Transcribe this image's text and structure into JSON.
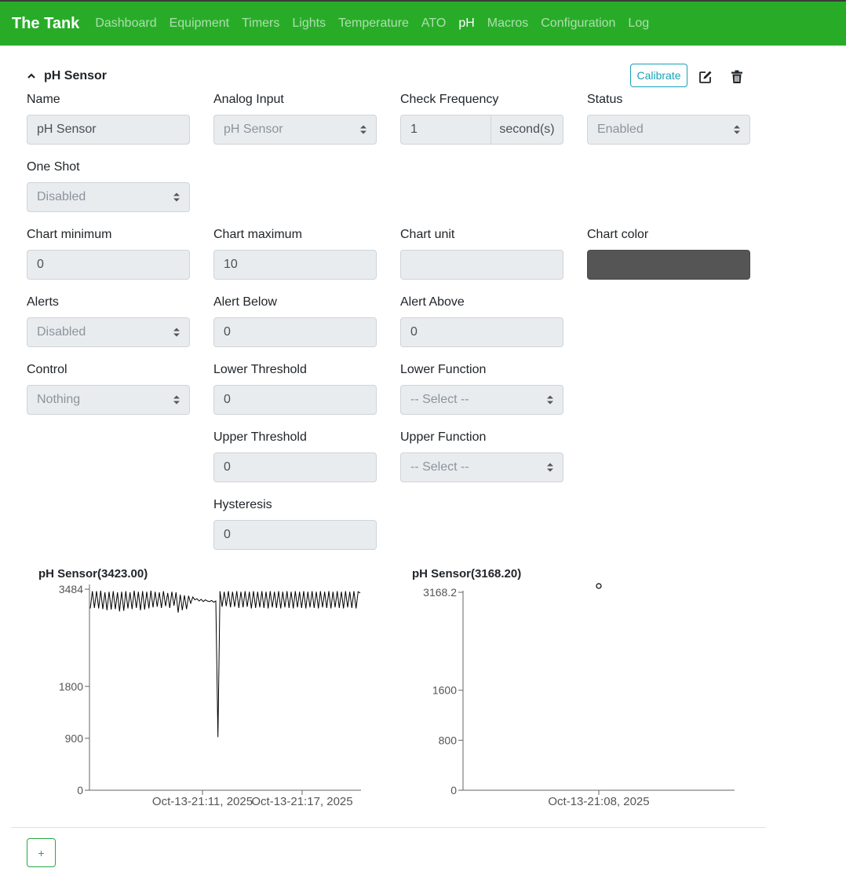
{
  "navbar": {
    "brand": "The Tank",
    "items": [
      {
        "label": "Dashboard",
        "active": false
      },
      {
        "label": "Equipment",
        "active": false
      },
      {
        "label": "Timers",
        "active": false
      },
      {
        "label": "Lights",
        "active": false
      },
      {
        "label": "Temperature",
        "active": false
      },
      {
        "label": "ATO",
        "active": false
      },
      {
        "label": "pH",
        "active": true
      },
      {
        "label": "Macros",
        "active": false
      },
      {
        "label": "Configuration",
        "active": false
      },
      {
        "label": "Log",
        "active": false
      }
    ]
  },
  "section": {
    "title": "pH Sensor",
    "collapse_icon": "chevron-up-icon",
    "calibrate_label": "Calibrate",
    "edit_icon": "edit-icon",
    "delete_icon": "trash-icon"
  },
  "form": {
    "name": {
      "label": "Name",
      "value": "pH Sensor"
    },
    "analog_input": {
      "label": "Analog Input",
      "value": "pH Sensor"
    },
    "check_frequency": {
      "label": "Check Frequency",
      "value": "1",
      "unit": "second(s)"
    },
    "status": {
      "label": "Status",
      "value": "Enabled"
    },
    "one_shot": {
      "label": "One Shot",
      "value": "Disabled"
    },
    "chart_min": {
      "label": "Chart minimum",
      "value": "0"
    },
    "chart_max": {
      "label": "Chart maximum",
      "value": "10"
    },
    "chart_unit": {
      "label": "Chart unit",
      "value": ""
    },
    "chart_color": {
      "label": "Chart color",
      "value": "#555555"
    },
    "alerts": {
      "label": "Alerts",
      "value": "Disabled"
    },
    "alert_below": {
      "label": "Alert Below",
      "value": "0"
    },
    "alert_above": {
      "label": "Alert Above",
      "value": "0"
    },
    "control": {
      "label": "Control",
      "value": "Nothing"
    },
    "lower_threshold": {
      "label": "Lower Threshold",
      "value": "0"
    },
    "lower_function": {
      "label": "Lower Function",
      "value": "-- Select --"
    },
    "upper_threshold": {
      "label": "Upper Threshold",
      "value": "0"
    },
    "upper_function": {
      "label": "Upper Function",
      "value": "-- Select --"
    },
    "hysteresis": {
      "label": "Hysteresis",
      "value": "0"
    }
  },
  "chart_data": [
    {
      "type": "line",
      "title": "pH Sensor(3423.00)",
      "ylim": [
        0,
        3540
      ],
      "yticks": [
        0,
        900,
        1800,
        3484
      ],
      "x_tick_labels": [
        "Oct-13-21:11, 2025",
        "Oct-13-21:17, 2025"
      ],
      "series": [
        {
          "values": [
            3150,
            3450,
            3160,
            3450,
            3150,
            3460,
            3140,
            3430,
            3120,
            3440,
            3130,
            3450,
            3140,
            3430,
            3100,
            3440,
            3110,
            3450,
            3150,
            3430,
            3140,
            3460,
            3160,
            3440,
            3120,
            3450,
            3130,
            3440,
            3150,
            3460,
            3170,
            3440,
            3180,
            3430,
            3160,
            3450,
            3190,
            3420,
            3160,
            3440,
            3200,
            3430,
            3080,
            3390,
            3120,
            3380,
            3140,
            3370,
            3240,
            3350,
            3300,
            3320,
            3280,
            3310,
            3270,
            3300,
            3280,
            3270,
            3290,
            3260,
            3280,
            920,
            3450,
            3180,
            3440,
            3190,
            3450,
            3170,
            3440,
            3180,
            3450,
            3160,
            3440,
            3170,
            3450,
            3180,
            3440,
            3150,
            3450,
            3160,
            3440,
            3170,
            3450,
            3160,
            3440,
            3150,
            3450,
            3170,
            3440,
            3160,
            3450,
            3150,
            3440,
            3170,
            3450,
            3160,
            3440,
            3150,
            3450,
            3170,
            3440,
            3160,
            3450,
            3150,
            3440,
            3170,
            3450,
            3160,
            3440,
            3150,
            3450,
            3170,
            3440,
            3160,
            3450,
            3150,
            3440,
            3170,
            3450,
            3160,
            3440,
            3150,
            3450,
            3170,
            3440,
            3160,
            3450,
            3150,
            3440,
            3420
          ]
        }
      ]
    },
    {
      "type": "scatter",
      "title": "pH Sensor(3168.20)",
      "ylim": [
        0,
        3168.2
      ],
      "yticks": [
        0,
        800,
        1600,
        3168.2
      ],
      "x_tick_labels": [
        "Oct-13-21:08, 2025"
      ],
      "series": [
        {
          "points": [
            {
              "x": "Oct-13-21:08, 2025",
              "y": 3168.2
            }
          ]
        }
      ]
    }
  ],
  "add_button_label": "+"
}
